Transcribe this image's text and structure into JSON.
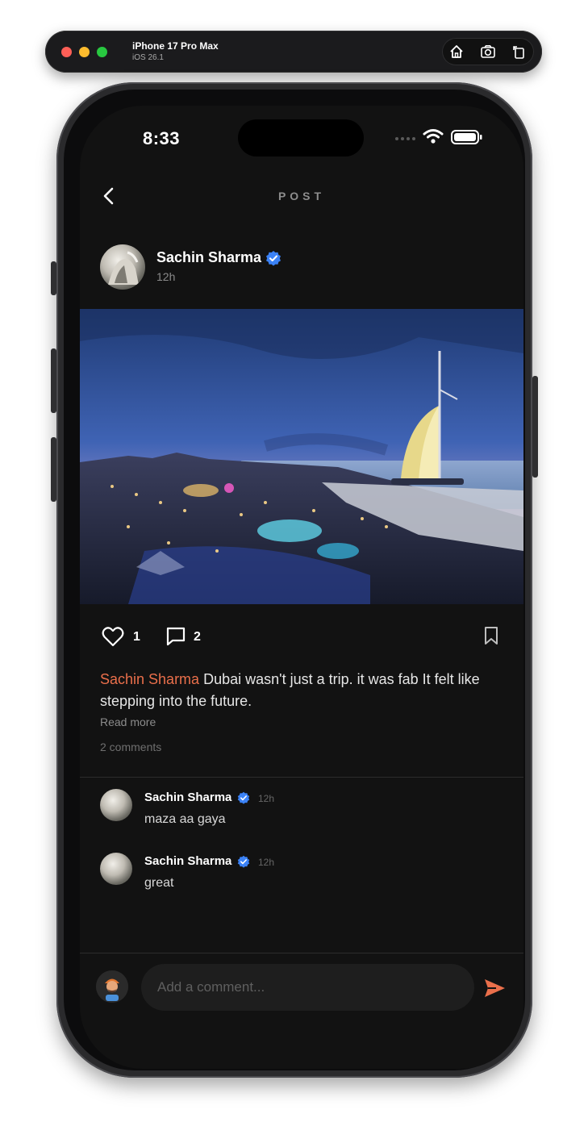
{
  "simulator": {
    "device_name": "iPhone 17 Pro Max",
    "os_version": "iOS 26.1"
  },
  "status_bar": {
    "time": "8:33"
  },
  "nav": {
    "title": "POST"
  },
  "post": {
    "author": "Sachin Sharma",
    "time": "12h",
    "like_count": "1",
    "comment_count": "2",
    "caption_user": "Sachin Sharma",
    "caption_text": "Dubai wasn't just a trip.  it was fab It felt like stepping into the future.",
    "read_more": "Read more",
    "comments_summary": "2 comments"
  },
  "comments": [
    {
      "author": "Sachin Sharma",
      "time": "12h",
      "text": "maza aa gaya"
    },
    {
      "author": "Sachin Sharma",
      "time": "12h",
      "text": "great"
    }
  ],
  "composer": {
    "placeholder": "Add a comment..."
  },
  "colors": {
    "accent": "#ea6f4b",
    "verified": "#3b82f6",
    "background": "#121212"
  }
}
